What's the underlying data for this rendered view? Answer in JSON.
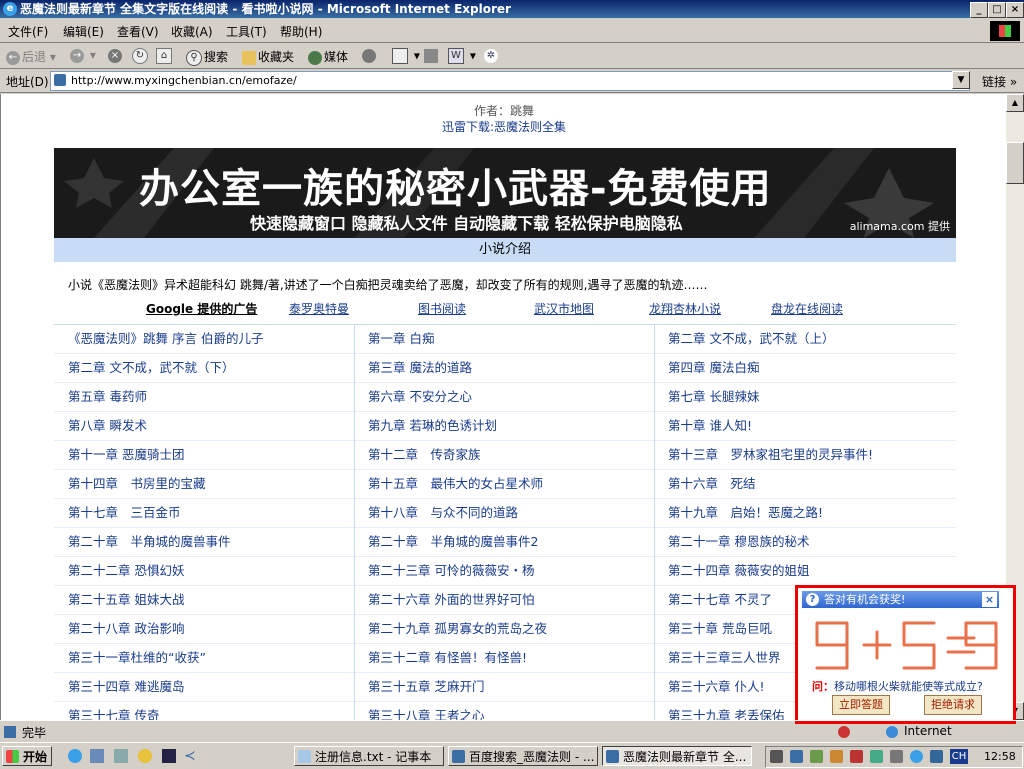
{
  "window": {
    "title": "恶魔法则最新章节 全集文字版在线阅读 - 看书啦小说网 - Microsoft Internet Explorer",
    "buttons": [
      "_",
      "□",
      "×"
    ]
  },
  "menu": [
    "文件(F)",
    "编辑(E)",
    "查看(V)",
    "收藏(A)",
    "工具(T)",
    "帮助(H)"
  ],
  "toolbar": {
    "back": "后退",
    "search": "搜索",
    "favorites": "收藏夹",
    "media": "媒体"
  },
  "address": {
    "label": "地址(D)",
    "url": "http://www.myxingchenbian.cn/emofaze/",
    "links": "链接"
  },
  "page": {
    "author": "作者：跳舞",
    "download": "迅雷下载:恶魔法则全集",
    "banner": {
      "line1": "办公室一族的秘密小武器-免费使用",
      "line2": "快速隐藏窗口 隐藏私人文件 自动隐藏下载 轻松保护电脑隐私",
      "provider": "alimama.com 提供"
    },
    "intro_header": "小说介绍",
    "intro": "小说《恶魔法则》异术超能科幻 跳舞/著,讲述了一个白痴把灵魂卖给了恶魔，却改变了所有的规则,遇寻了恶魔的轨迹……",
    "ads_label": "Google 提供的广告",
    "ad_links": [
      "泰罗奥特曼",
      "图书阅读",
      "武汉市地图",
      "龙翔杏林小说",
      "盘龙在线阅读"
    ],
    "chapters": [
      [
        "《恶魔法则》跳舞 序言 伯爵的儿子",
        "第一章 白痴",
        "第二章 文不成，武不就（上）"
      ],
      [
        "第二章 文不成，武不就（下）",
        "第三章 魔法的道路",
        "第四章 魔法白痴"
      ],
      [
        "第五章 毒药师",
        "第六章 不安分之心",
        "第七章 长腿辣妹"
      ],
      [
        "第八章 瞬发术",
        "第九章 若琳的色诱计划",
        "第十章 谁人知!"
      ],
      [
        "第十一章 恶魔骑士团",
        "第十二章　传奇家族",
        "第十三章　罗林家祖宅里的灵异事件!"
      ],
      [
        "第十四章　书房里的宝藏",
        "第十五章　最伟大的女占星术师",
        "第十六章　死结"
      ],
      [
        "第十七章　三百金币",
        "第十八章　与众不同的道路",
        "第十九章　启始！恶魔之路!"
      ],
      [
        "第二十章　半角城的魔兽事件",
        "第二十章　半角城的魔兽事件2",
        "第二十一章 穆恩族的秘术"
      ],
      [
        "第二十二章 恐惧幻妖",
        "第二十三章 可怜的薇薇安・杨",
        "第二十四章 薇薇安的姐姐"
      ],
      [
        "第二十五章 姐妹大战",
        "第二十六章 外面的世界好可怕",
        "第二十七章 不灵了"
      ],
      [
        "第二十八章 政治影响",
        "第二十九章 孤男寡女的荒岛之夜",
        "第三十章 荒岛巨吼"
      ],
      [
        "第三十一章杜维的“收获”",
        "第三十二章 有怪兽！有怪兽!",
        "第三十三章三人世界"
      ],
      [
        "第三十四章 难逃魔岛",
        "第三十五章 芝麻开门",
        "第三十六章 仆人!"
      ],
      [
        "第三十七章 传奇",
        "第三十八章 王者之心",
        "第三十九章 老丢保佑"
      ]
    ]
  },
  "popup": {
    "title": "答对有机会获奖!",
    "close": "×",
    "question": "问：移动哪根火柴就能使等式成立?",
    "question_prefix": "问：",
    "question_body": "移动哪根火柴就能使等式成立?",
    "answer_btn": "立即答题",
    "reject_btn": "拒绝请求"
  },
  "status": {
    "text": "完毕",
    "zone": "Internet"
  },
  "taskbar": {
    "start": "开始",
    "tasks": [
      "注册信息.txt - 记事本",
      "百度搜索_恶魔法则 - ...",
      "恶魔法则最新章节 全..."
    ],
    "ime": "CH",
    "clock": "12:58"
  }
}
